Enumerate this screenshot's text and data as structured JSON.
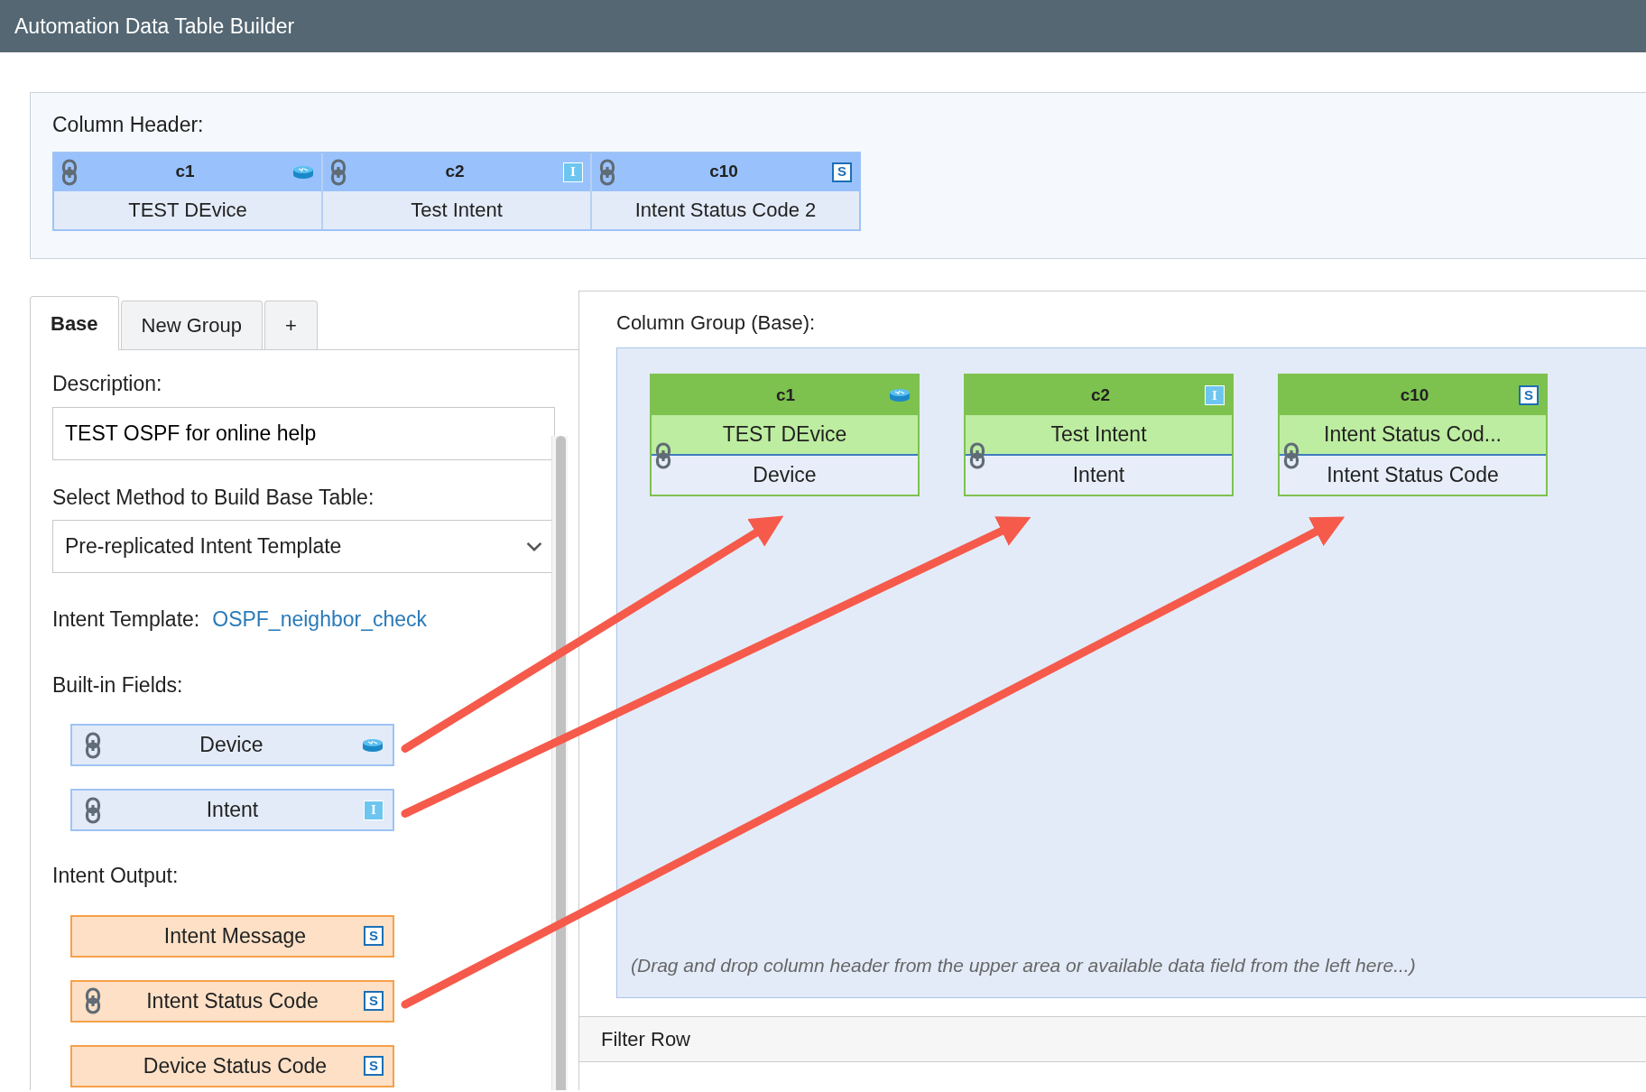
{
  "window": {
    "title": "Automation Data Table Builder"
  },
  "column_header": {
    "label": "Column Header:",
    "columns": [
      {
        "name": "c1",
        "display": "TEST DEvice",
        "linked": true,
        "kind": "device"
      },
      {
        "name": "c2",
        "display": "Test Intent",
        "linked": true,
        "kind": "intent",
        "type_mark": "I"
      },
      {
        "name": "c10",
        "display": "Intent Status Code 2",
        "linked": true,
        "kind": "string",
        "type_mark": "S"
      }
    ]
  },
  "tabs": [
    {
      "label": "Base",
      "selected": true
    },
    {
      "label": "New Group",
      "selected": false
    },
    {
      "label": "+",
      "selected": false
    }
  ],
  "description": {
    "label": "Description:",
    "value": "TEST OSPF for online help"
  },
  "method": {
    "label": "Select Method to Build Base Table:",
    "value": "Pre-replicated Intent Template"
  },
  "intent_template": {
    "label": "Intent Template:",
    "link": "OSPF_neighbor_check"
  },
  "builtin_fields": {
    "label": "Built-in Fields:",
    "items": [
      {
        "label": "Device",
        "linked": true,
        "kind": "device",
        "arrow_out": true
      },
      {
        "label": "Intent",
        "linked": true,
        "kind": "intent",
        "type_mark": "I",
        "arrow_out": true
      }
    ]
  },
  "intent_output": {
    "label": "Intent Output:",
    "items": [
      {
        "label": "Intent Message",
        "linked": false,
        "kind": "string",
        "type_mark": "S",
        "arrow_out": false
      },
      {
        "label": "Intent Status Code",
        "linked": true,
        "kind": "string",
        "type_mark": "S",
        "arrow_out": true
      },
      {
        "label": "Device Status Code",
        "linked": false,
        "kind": "string",
        "type_mark": "S",
        "arrow_out": false
      }
    ]
  },
  "column_group": {
    "label": "Column Group (Base):",
    "columns": [
      {
        "name": "c1",
        "display": "TEST DEvice",
        "source": "Device",
        "linked": true,
        "kind": "device"
      },
      {
        "name": "c2",
        "display": "Test Intent",
        "source": "Intent",
        "linked": true,
        "kind": "intent",
        "type_mark": "I"
      },
      {
        "name": "c10",
        "display": "Intent Status Cod...",
        "source": "Intent Status Code",
        "linked": true,
        "kind": "string",
        "type_mark": "S"
      }
    ],
    "hint": "(Drag and drop column header from the upper area or available data field from the left here...)"
  },
  "filter_row": {
    "label": "Filter Row"
  }
}
